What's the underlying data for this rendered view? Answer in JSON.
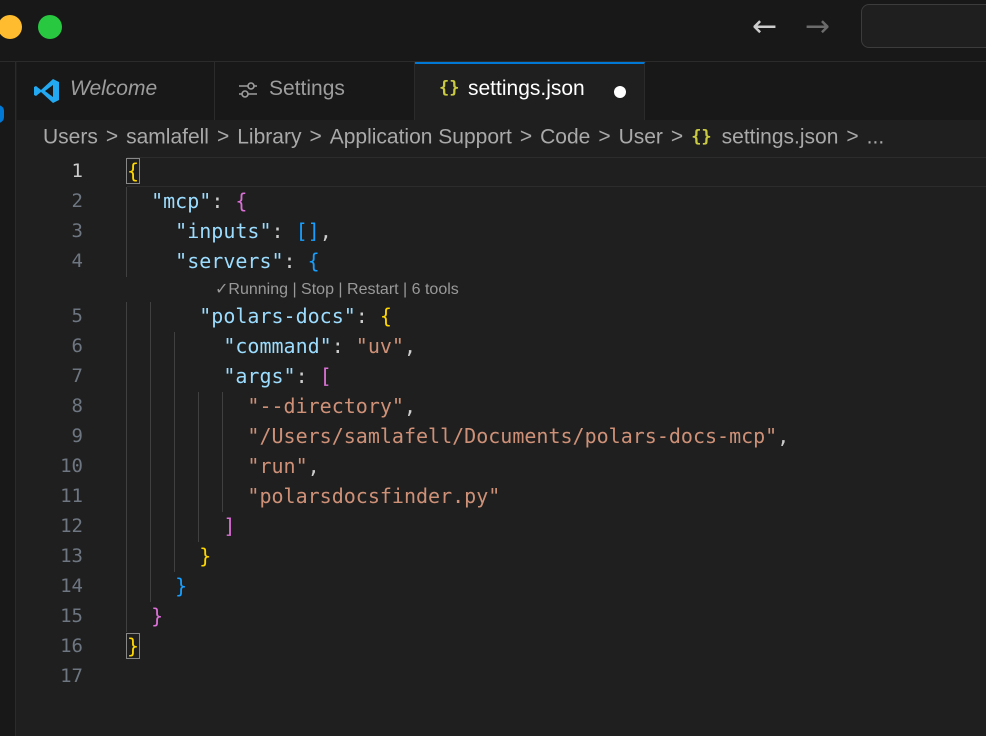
{
  "window": {
    "back_icon": "arrow-left",
    "forward_icon": "arrow-right",
    "back_glyph": "←",
    "forward_glyph": "→"
  },
  "tabs": [
    {
      "label": "Welcome",
      "icon": "vscode-logo"
    },
    {
      "label": "Settings",
      "icon": "settings-sliders-icon"
    },
    {
      "label": "settings.json",
      "icon": "json-braces-icon",
      "icon_glyph": "{}",
      "active": true,
      "dirty": true
    }
  ],
  "breadcrumb": {
    "items": [
      "Users",
      "samlafell",
      "Library",
      "Application Support",
      "Code",
      "User"
    ],
    "file_icon_glyph": "{}",
    "file": "settings.json",
    "separator": ">",
    "trailing": "..."
  },
  "editor": {
    "line_numbers": [
      "1",
      "2",
      "3",
      "4",
      "5",
      "6",
      "7",
      "8",
      "9",
      "10",
      "11",
      "12",
      "13",
      "14",
      "15",
      "16",
      "17"
    ],
    "current_line": 1,
    "codelens": "✓Running | Stop | Restart | 6 tools",
    "code": {
      "mcp_key": "\"mcp\"",
      "inputs_key": "\"inputs\"",
      "servers_key": "\"servers\"",
      "polars_key": "\"polars-docs\"",
      "command_key": "\"command\"",
      "command_val": "\"uv\"",
      "args_key": "\"args\"",
      "arg1": "\"--directory\"",
      "arg2": "\"/Users/samlafell/Documents/polars-docs-mcp\"",
      "arg3": "\"run\"",
      "arg4": "\"polarsdocsfinder.py\""
    }
  },
  "colors": {
    "accent": "#0078d4",
    "json_key": "#9cdcfe",
    "json_string": "#ce9178",
    "bracket_level1": "#ffd700",
    "bracket_level2": "#da70d6",
    "bracket_level3": "#179fff"
  }
}
